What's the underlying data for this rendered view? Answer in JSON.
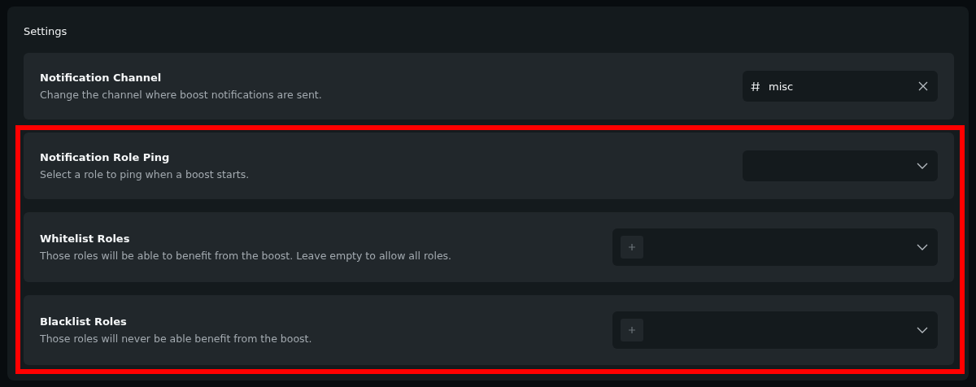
{
  "panel": {
    "title": "Settings"
  },
  "settings": [
    {
      "title": "Notification Channel",
      "description": "Change the channel where boost notifications are sent.",
      "highlighted": false,
      "control": {
        "kind": "channel",
        "value": "misc"
      }
    },
    {
      "title": "Notification Role Ping",
      "description": "Select a role to ping when a boost starts.",
      "highlighted": true,
      "control": {
        "kind": "single"
      }
    },
    {
      "title": "Whitelist Roles",
      "description": "Those roles will be able to benefit from the boost. Leave empty to allow all roles.",
      "highlighted": true,
      "control": {
        "kind": "multi"
      }
    },
    {
      "title": "Blacklist Roles",
      "description": "Those roles will never be able benefit from the boost.",
      "highlighted": true,
      "control": {
        "kind": "multi"
      }
    }
  ]
}
